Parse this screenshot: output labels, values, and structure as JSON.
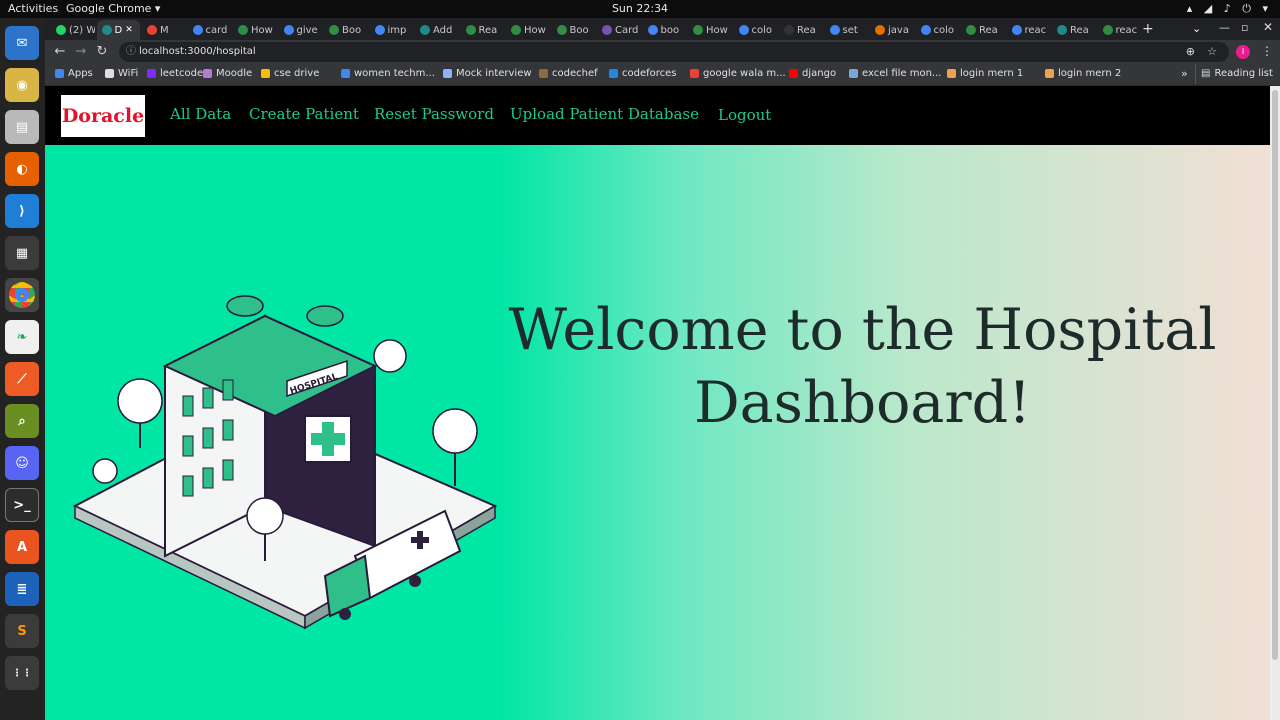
{
  "system": {
    "activities": "Activities",
    "app_name": "Google Chrome",
    "clock": "Sun 22:34"
  },
  "tabs": [
    {
      "label": "(2) W",
      "color": "#25d366"
    },
    {
      "label": "D",
      "color": "#1f8a8a"
    },
    {
      "label": "M",
      "color": "#ea4335"
    },
    {
      "label": "card",
      "color": "#4285f4"
    },
    {
      "label": "How",
      "color": "#2f8d46"
    },
    {
      "label": "give",
      "color": "#4285f4"
    },
    {
      "label": "Boo",
      "color": "#2f8d46"
    },
    {
      "label": "imp",
      "color": "#4285f4"
    },
    {
      "label": "Add",
      "color": "#1f8a8a"
    },
    {
      "label": "Rea",
      "color": "#2f8d46"
    },
    {
      "label": "How",
      "color": "#2f8d46"
    },
    {
      "label": "Boo",
      "color": "#2f8d46"
    },
    {
      "label": "Card",
      "color": "#7952b3"
    },
    {
      "label": "boo",
      "color": "#4285f4"
    },
    {
      "label": "How",
      "color": "#2f8d46"
    },
    {
      "label": "colo",
      "color": "#4285f4"
    },
    {
      "label": "Rea",
      "color": "#333333"
    },
    {
      "label": "set",
      "color": "#4285f4"
    },
    {
      "label": "java",
      "color": "#e76f00"
    },
    {
      "label": "colo",
      "color": "#4285f4"
    },
    {
      "label": "Rea",
      "color": "#2f8d46"
    },
    {
      "label": "reac",
      "color": "#4285f4"
    },
    {
      "label": "Rea",
      "color": "#1f8a8a"
    },
    {
      "label": "reac",
      "color": "#2f8d46"
    }
  ],
  "address": {
    "url": "localhost:3000/hospital"
  },
  "bookmarks": [
    {
      "label": "Apps",
      "color": "#4285f4"
    },
    {
      "label": "WiFi",
      "color": "#dddddd"
    },
    {
      "label": "leetcode",
      "color": "#7b2cff"
    },
    {
      "label": "Moodle",
      "color": "#b07cd8"
    },
    {
      "label": "cse drive",
      "color": "#fbbc04"
    },
    {
      "label": "women techm...",
      "color": "#4285f4"
    },
    {
      "label": "Mock interview",
      "color": "#8ab4f8"
    },
    {
      "label": "codechef",
      "color": "#8a6d3b"
    },
    {
      "label": "codeforces",
      "color": "#1e88e5"
    },
    {
      "label": "google wala m...",
      "color": "#ea4335"
    },
    {
      "label": "django",
      "color": "#ff0000"
    },
    {
      "label": "excel file mon...",
      "color": "#7aa7d8"
    },
    {
      "label": "login mern 1",
      "color": "#f0a050"
    },
    {
      "label": "login mern 2",
      "color": "#f0a050"
    }
  ],
  "bookmarks_more": "»",
  "reading_list": "Reading list",
  "site": {
    "brand": "Doracle",
    "nav": [
      "All Data",
      "Create Patient",
      "Reset Password",
      "Upload Patient Database",
      "Logout"
    ],
    "welcome_line1": "Welcome to the Hospital",
    "welcome_line2": "Dashboard!",
    "sign_text": "HOSPITAL"
  },
  "colors": {
    "accent": "#1ec98a",
    "brand_red": "#e0132a",
    "hero_green": "#00e6a5",
    "hero_peach": "#f2dfd6"
  }
}
